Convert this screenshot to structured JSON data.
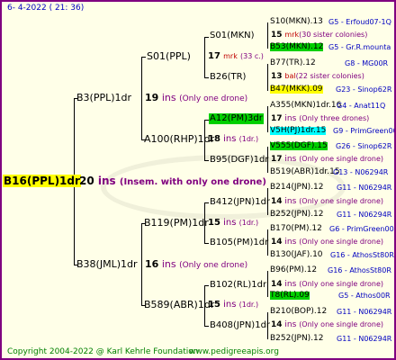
{
  "header": {
    "text": "6-  4-2022 ( 21: 36)"
  },
  "footer": {
    "copyright": "Copyright 2004-2022 @ Karl Kehrle Foundation",
    "url": "www.pedigreeapis.org"
  },
  "root": {
    "name": "B16(PPL)1dr",
    "num": "20",
    "ins": "ins",
    "note": "(Insem. with only one drone)"
  },
  "g1": [
    {
      "name": "B3(PPL)1dr",
      "num": "19",
      "ins": "ins",
      "note": "(Only one drone)"
    },
    {
      "name": "B38(JML)1dr",
      "num": "16",
      "ins": "ins",
      "note": "(Only one drone)"
    }
  ],
  "g2": [
    {
      "name": "S01(PPL)",
      "num": "17",
      "ins": "mrk",
      "note": "(33 c.)"
    },
    {
      "name": "A100(RHP)1dr",
      "num": "18",
      "ins": "ins",
      "note": "(1dr.)"
    },
    {
      "name": "B119(PM)1dr",
      "num": "15",
      "ins": "ins",
      "note": "(1dr.)"
    },
    {
      "name": "B589(ABR)1dr",
      "num": "15",
      "ins": "ins",
      "note": "(1dr.)"
    }
  ],
  "g3": [
    {
      "name": "S01(MKN)",
      "num": "15",
      "ins": "mrk",
      "note": "(30 sister colonies)"
    },
    {
      "name": "B26(TR)",
      "num": "13",
      "ins": "bal",
      "note": "(22 sister colonies)"
    },
    {
      "name": "A12(PM)3dr",
      "num": "17",
      "ins": "ins",
      "note": "(Only three drones)"
    },
    {
      "name": "B95(DGF)1dr",
      "num": "17",
      "ins": "ins",
      "note": "(Only one single drone)"
    },
    {
      "name": "B412(JPN)1dr",
      "num": "14",
      "ins": "ins",
      "note": "(Only one single drone)"
    },
    {
      "name": "B105(PM)1dr",
      "num": "14",
      "ins": "ins",
      "note": "(Only one single drone)"
    },
    {
      "name": "B102(RL)1dr",
      "num": "14",
      "ins": "ins",
      "note": "(Only one single drone)"
    },
    {
      "name": "B408(JPN)1dr",
      "num": "14",
      "ins": "ins",
      "note": "(Only one single drone)"
    }
  ],
  "g4": [
    {
      "name": "S10(MKN).13",
      "code": "G5 - Erfoud07-1Q"
    },
    {
      "name": "B53(MKN).12",
      "code": "G5 - Gr.R.mounta"
    },
    {
      "name": "B77(TR).12",
      "code": "G8 - MG00R"
    },
    {
      "name": "B47(MKK).09",
      "code": "G23 - Sinop62R"
    },
    {
      "name": "A355(MKN)1dr.16",
      "code": "G4 - Anat11Q"
    },
    {
      "name": "V5H(PJ)1dr.15",
      "code": "G9 - PrimGreen00"
    },
    {
      "name": "V555(DGF).15",
      "code": "G26 - Sinop62R"
    },
    {
      "name": "B519(ABR)1dr.15",
      "code": "G13 - N06294R"
    },
    {
      "name": "B214(JPN).12",
      "code": "G11 - N06294R"
    },
    {
      "name": "B252(JPN).12",
      "code": "G11 - N06294R"
    },
    {
      "name": "B170(PM).12",
      "code": "G6 - PrimGreen00"
    },
    {
      "name": "B130(JAF).10",
      "code": "G16 - AthosSt80R"
    },
    {
      "name": "B96(PM).12",
      "code": "G16 - AthosSt80R"
    },
    {
      "name": "T8(RL).09",
      "code": "G5 - Athos00R"
    },
    {
      "name": "B210(BOP).12",
      "code": "G11 - N06294R"
    },
    {
      "name": "B252(JPN).12",
      "code": "G11 - N06294R"
    }
  ]
}
